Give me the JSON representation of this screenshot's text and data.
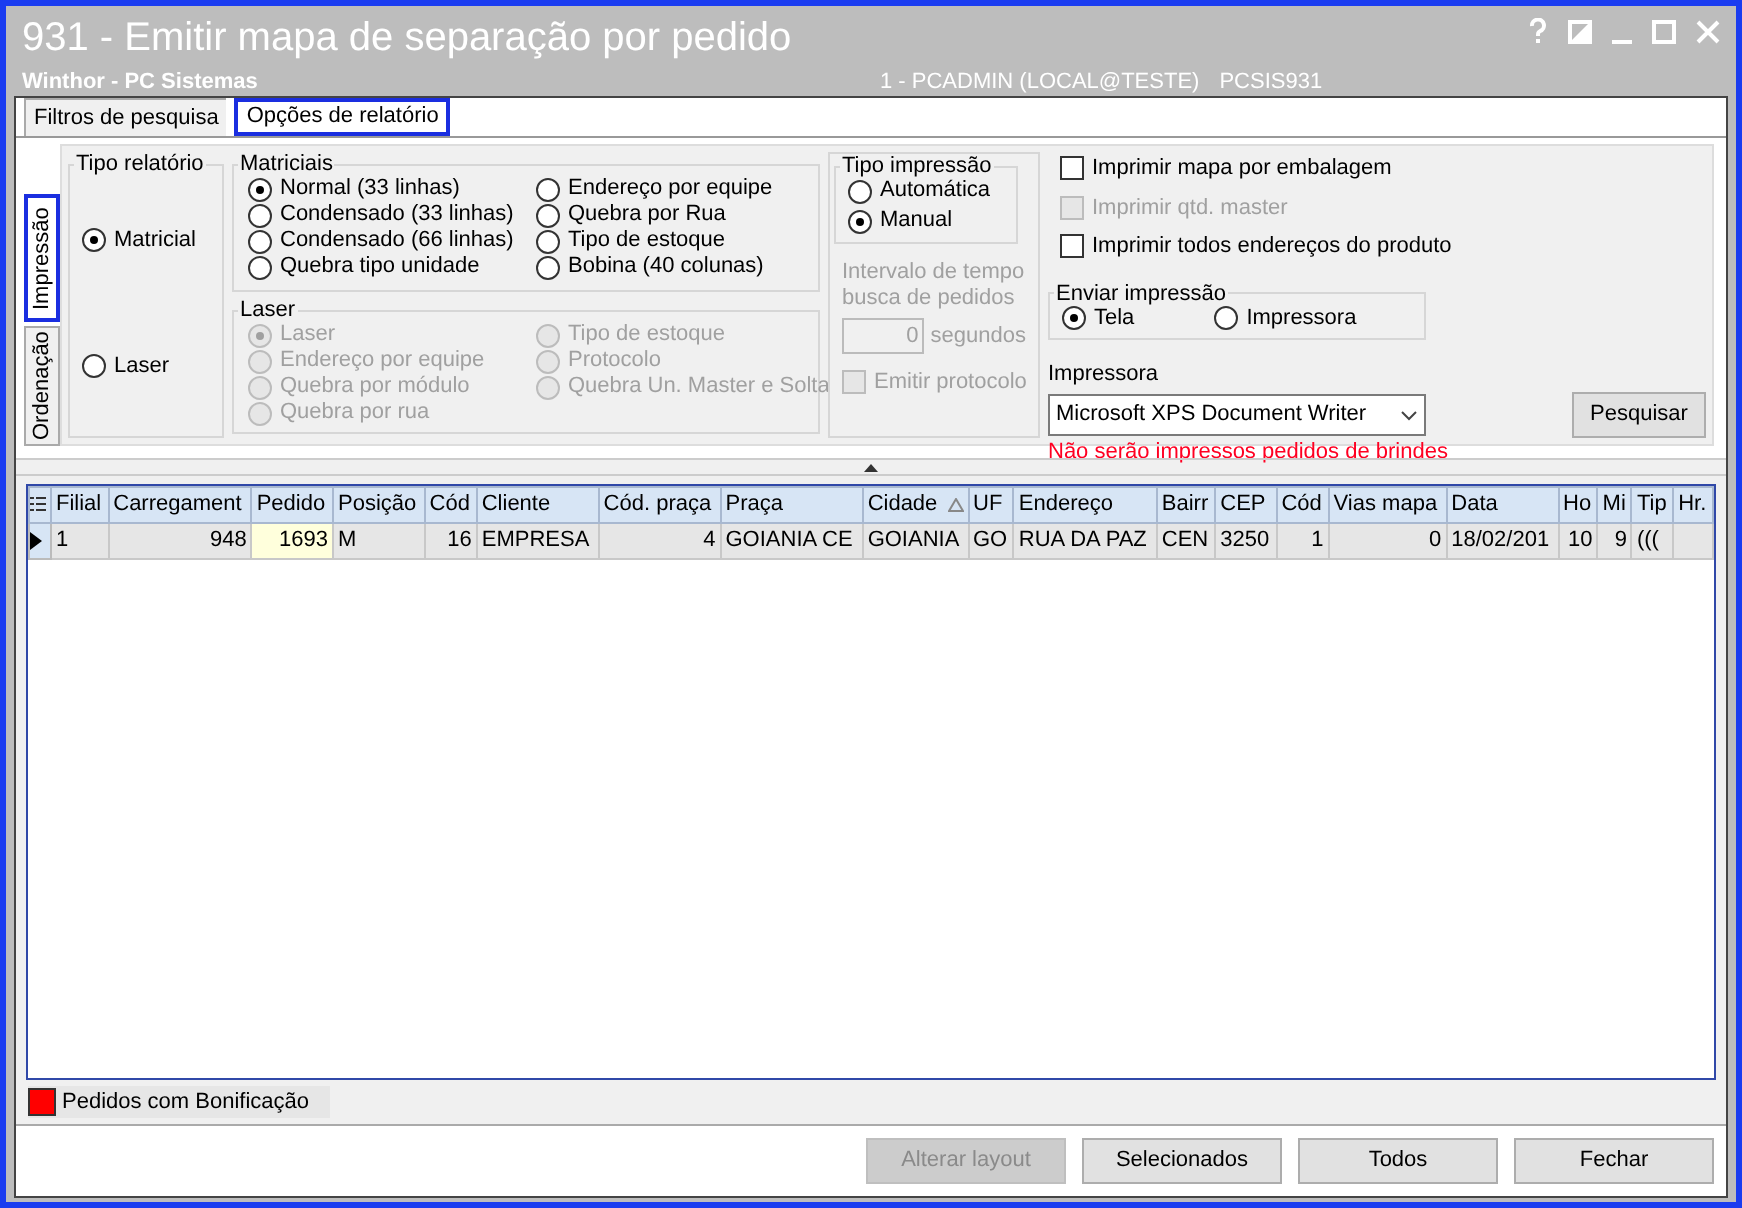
{
  "window": {
    "title": "931 - Emitir mapa de separação por pedido",
    "subtitle": "Winthor - PC Sistemas",
    "session": "1 - PCADMIN (LOCAL@TESTE)",
    "program": "PCSIS931"
  },
  "tabs": [
    {
      "label": "Filtros de pesquisa",
      "selected": false
    },
    {
      "label": "Opções de relatório",
      "selected": true
    }
  ],
  "side_tabs": [
    {
      "label": "Impressão",
      "selected": true
    },
    {
      "label": "Ordenação",
      "selected": false
    }
  ],
  "tipo_relatorio": {
    "title": "Tipo relatório",
    "options": [
      {
        "label": "Matricial",
        "selected": true
      },
      {
        "label": "Laser",
        "selected": false
      }
    ]
  },
  "matriciais": {
    "title": "Matriciais",
    "options": [
      {
        "label": "Normal (33 linhas)",
        "selected": true
      },
      {
        "label": "Endereço por equipe",
        "selected": false
      },
      {
        "label": "Condensado (33 linhas)",
        "selected": false
      },
      {
        "label": "Quebra por Rua",
        "selected": false
      },
      {
        "label": "Condensado (66 linhas)",
        "selected": false
      },
      {
        "label": "Tipo de estoque",
        "selected": false
      },
      {
        "label": "Quebra tipo unidade",
        "selected": false
      },
      {
        "label": "Bobina (40 colunas)",
        "selected": false
      }
    ]
  },
  "laser": {
    "title": "Laser",
    "disabled": true,
    "options": [
      {
        "label": "Laser",
        "selected": true
      },
      {
        "label": "Tipo de estoque",
        "selected": false
      },
      {
        "label": "Endereço por equipe",
        "selected": false
      },
      {
        "label": "Protocolo",
        "selected": false
      },
      {
        "label": "Quebra por módulo",
        "selected": false
      },
      {
        "label": "Quebra Un. Master e Solta",
        "selected": false
      },
      {
        "label": "Quebra por rua",
        "selected": false
      }
    ]
  },
  "tipo_impressao": {
    "title": "Tipo impressão",
    "options": [
      {
        "label": "Automática",
        "selected": false
      },
      {
        "label": "Manual",
        "selected": true
      }
    ]
  },
  "intervalo": {
    "label": "Intervalo de tempo busca de pedidos",
    "value": "0",
    "unit": "segundos",
    "disabled": true
  },
  "emitir_protocolo": {
    "label": "Emitir protocolo",
    "checked": false,
    "disabled": true
  },
  "checkboxes": [
    {
      "label": "Imprimir mapa por embalagem",
      "checked": false,
      "disabled": false
    },
    {
      "label": "Imprimir qtd. master",
      "checked": false,
      "disabled": true
    },
    {
      "label": "Imprimir todos endereços do produto",
      "checked": false,
      "disabled": false
    }
  ],
  "enviar_impressao": {
    "title": "Enviar impressão",
    "options": [
      {
        "label": "Tela",
        "selected": true
      },
      {
        "label": "Impressora",
        "selected": false
      }
    ]
  },
  "impressora": {
    "label": "Impressora",
    "value": "Microsoft XPS Document Writer",
    "warning": "Não serão impressos pedidos de brindes"
  },
  "search_button": "Pesquisar",
  "table": {
    "columns": [
      {
        "label": "Filial",
        "sorted": false
      },
      {
        "label": "Carregament",
        "sorted": false
      },
      {
        "label": "Pedido",
        "sorted": false
      },
      {
        "label": "Posição",
        "sorted": false
      },
      {
        "label": "Cód",
        "sorted": false
      },
      {
        "label": "Cliente",
        "sorted": false
      },
      {
        "label": "Cód. praça",
        "sorted": false
      },
      {
        "label": "Praça",
        "sorted": false
      },
      {
        "label": "Cidade",
        "sorted": true
      },
      {
        "label": "UF",
        "sorted": false
      },
      {
        "label": "Endereço",
        "sorted": false
      },
      {
        "label": "Bairr",
        "sorted": false
      },
      {
        "label": "CEP",
        "sorted": false
      },
      {
        "label": "Cód",
        "sorted": false
      },
      {
        "label": "Vias mapa",
        "sorted": false
      },
      {
        "label": "Data",
        "sorted": false
      },
      {
        "label": "Ho",
        "sorted": false
      },
      {
        "label": "Mi",
        "sorted": false
      },
      {
        "label": "Tip",
        "sorted": false
      },
      {
        "label": "Hr.",
        "sorted": false
      }
    ],
    "rows": [
      {
        "current": true,
        "cells": [
          {
            "text": "1"
          },
          {
            "text": "948",
            "numeric": true
          },
          {
            "text": "1693",
            "numeric": true,
            "focused": true
          },
          {
            "text": "M"
          },
          {
            "text": "16",
            "numeric": true
          },
          {
            "text": "EMPRESA"
          },
          {
            "text": "4",
            "numeric": true
          },
          {
            "text": "GOIANIA CE"
          },
          {
            "text": "GOIANIA"
          },
          {
            "text": "GO"
          },
          {
            "text": "RUA DA PAZ"
          },
          {
            "text": "CEN"
          },
          {
            "text": "3250"
          },
          {
            "text": "1",
            "numeric": true
          },
          {
            "text": "0",
            "numeric": true
          },
          {
            "text": "18/02/201"
          },
          {
            "text": "10",
            "numeric": true
          },
          {
            "text": "9",
            "numeric": true
          },
          {
            "text": "((("
          },
          {}
        ]
      }
    ]
  },
  "legend": [
    {
      "label": "Pedidos com Bonificação",
      "color": "#ff0000"
    }
  ],
  "buttons": [
    {
      "label": "Alterar layout",
      "disabled": true
    },
    {
      "label": "Selecionados",
      "disabled": false
    },
    {
      "label": "Todos",
      "disabled": false
    },
    {
      "label": "Fechar",
      "disabled": false
    }
  ]
}
